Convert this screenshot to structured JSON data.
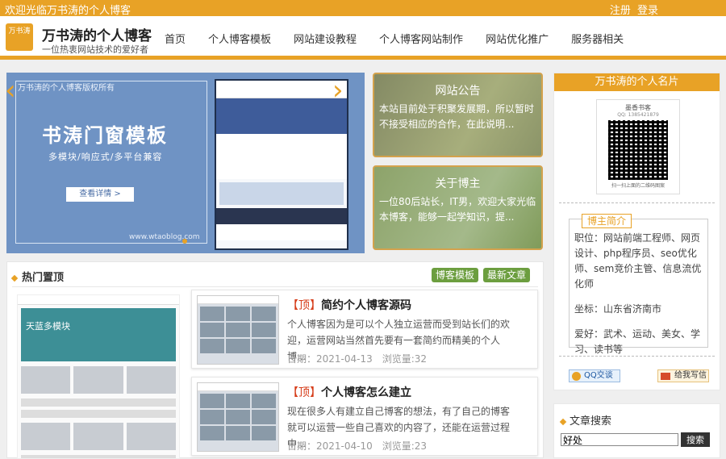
{
  "topbar": {
    "welcome": "欢迎光临万书涛的个人博客",
    "register": "注册",
    "login": "登录"
  },
  "header": {
    "logo_text": "万书涛",
    "title": "万书涛的个人博客",
    "subtitle": "一位热衷网站技术的爱好者",
    "nav": [
      "首页",
      "个人博客模板",
      "网站建设教程",
      "个人博客网站制作",
      "网站优化推广",
      "服务器相关"
    ]
  },
  "banner": {
    "copyright": "万书涛的个人博客版权所有",
    "headline": "书涛门窗模板",
    "subline": "多模块/响应式/多平台兼容",
    "button": "查看详情 >",
    "url": "www.wtaoblog.com",
    "prev": "‹",
    "next": "›",
    "accent": "#e8a226"
  },
  "cards": [
    {
      "title": "网站公告",
      "text": "本站目前处于积聚发展期，所以暂时不接受相应的合作，在此说明..."
    },
    {
      "title": "关于博主",
      "text": "一位80后站长，IT男，欢迎大家光临本博客，能够一起学知识，提..."
    }
  ],
  "sidebar": {
    "card_title": "万书涛的个人名片",
    "qr_title": "墨香书客",
    "qr_sub": "QQ: 1385421879",
    "qr_bottom": "扫一扫上面的二维码图案",
    "bio_title": "博主简介",
    "job": "职位：网站前端工程师、网页设计、php程序员、seo优化师、sem竞价主管、信息流优化师",
    "location": "坐标：山东省济南市",
    "hobby": "爱好：武术、运动、美女、学习、读书等",
    "qq_btn": "QQ交谈",
    "mail_btn": "给我写信"
  },
  "search": {
    "title": "文章搜索",
    "value": "好处",
    "button": "搜索"
  },
  "hot": {
    "title": "热门置顶",
    "tags": [
      "博客模板",
      "最新文章"
    ],
    "preview_text": "天蓝多模块",
    "posts": [
      {
        "mark": "【顶】",
        "title": "简约个人博客源码",
        "desc": "个人博客因为是可以个人独立运营而受到站长们的欢迎，运营网站当然首先要有一套简约而精美的个人博...",
        "date": "日期：2021-04-13",
        "views": "浏览量:32"
      },
      {
        "mark": "【顶】",
        "title": "个人博客怎么建立",
        "desc": "现在很多人有建立自己博客的想法，有了自己的博客就可以运营一些自己喜欢的内容了，还能在运营过程中...",
        "date": "日期：2021-04-10",
        "views": "浏览量:23"
      }
    ]
  }
}
